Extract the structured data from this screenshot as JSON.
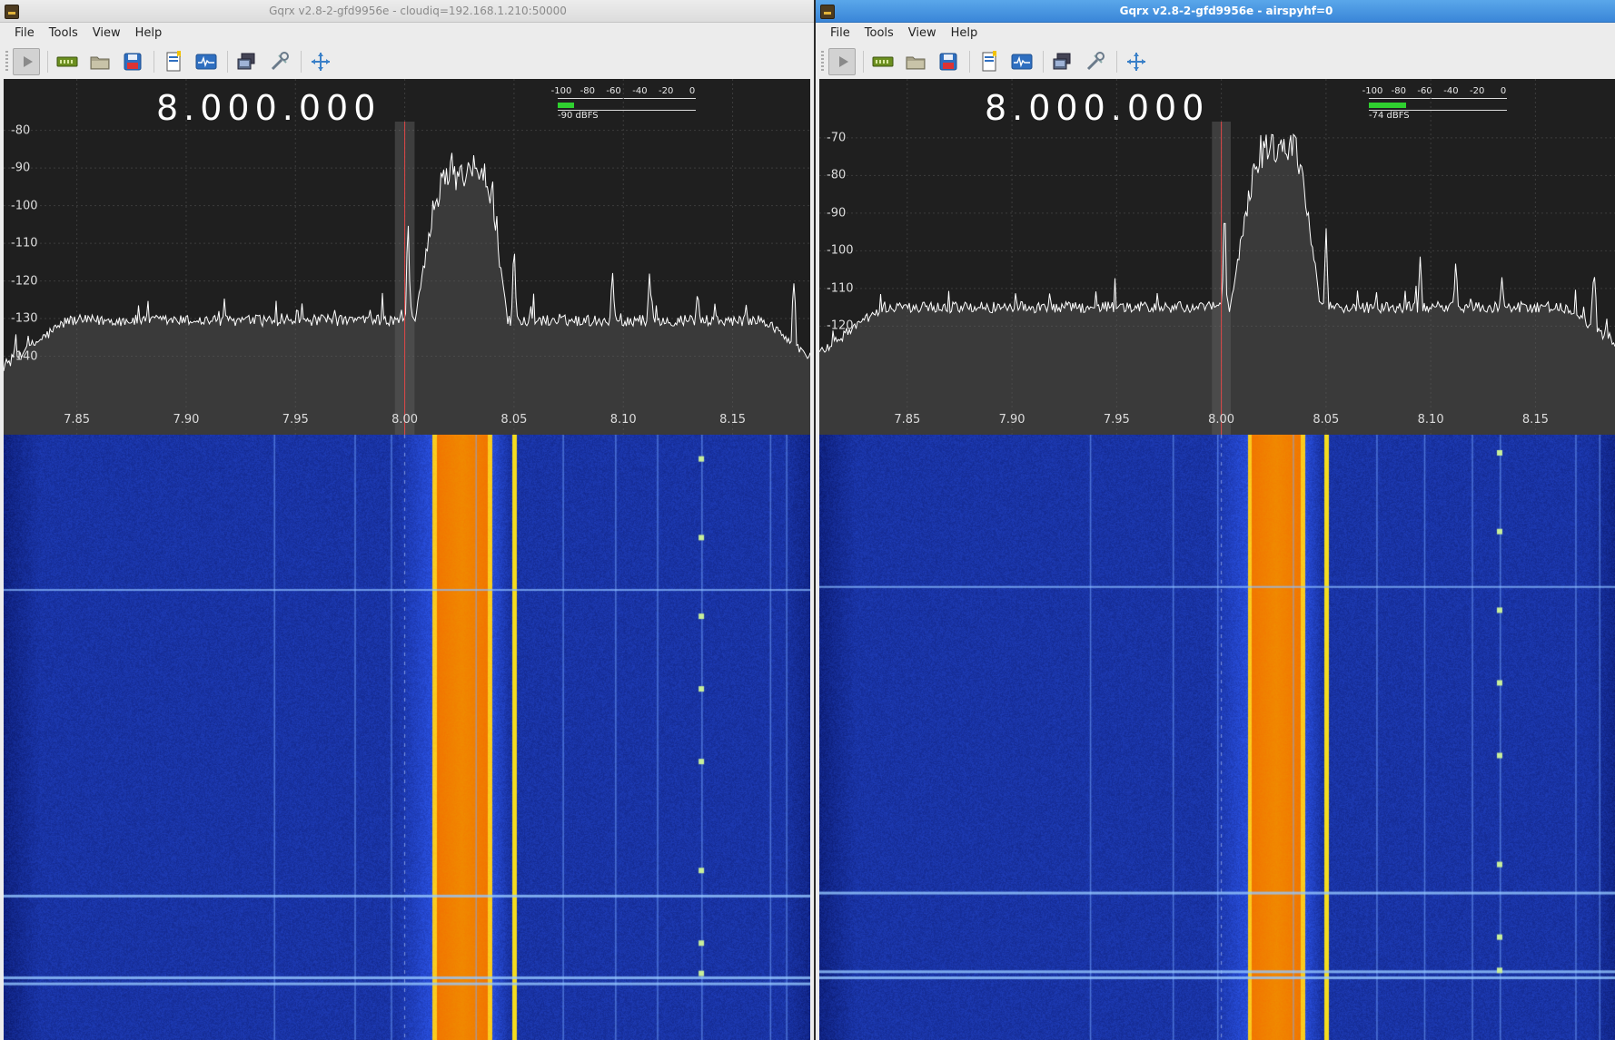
{
  "windows": [
    {
      "id": "left",
      "title": "Gqrx v2.8-2-gfd9956e - cloudiq=192.168.1.210:50000",
      "active": false,
      "menu": [
        "File",
        "Tools",
        "View",
        "Help"
      ],
      "toolbar": [
        {
          "name": "start-dsp-icon",
          "pressed": true
        },
        {
          "name": "io-devices-icon"
        },
        {
          "name": "open-settings-icon"
        },
        {
          "name": "save-settings-icon"
        },
        {
          "name": "bookmark-icon"
        },
        {
          "name": "fft-settings-icon"
        },
        {
          "name": "remote-control-icon"
        },
        {
          "name": "tools-icon"
        },
        {
          "name": "fullscreen-icon"
        }
      ],
      "frequency": "8.000.000",
      "smeter": {
        "scale": [
          "-100",
          "-80",
          "-60",
          "-40",
          "-20",
          "0"
        ],
        "readout": "-90 dBFS",
        "level_dbfs": -90
      },
      "spectrum": {
        "db_ticks": [
          "-80",
          "-90",
          "-100",
          "-110",
          "-120",
          "-130",
          "-140"
        ],
        "db_max": -76,
        "db_min": -143,
        "floor_db": -130.5,
        "peak_db": -93,
        "freq_ticks": [
          "7.85",
          "7.90",
          "7.95",
          "8.00",
          "8.05",
          "8.10",
          "8.15"
        ],
        "freq_min_mhz": 7.8165,
        "freq_max_mhz": 8.1855
      },
      "waterfall": {
        "hlines": [
          0.255,
          0.76,
          0.895,
          0.905
        ],
        "vlines": [
          0.335,
          0.435,
          0.48,
          0.585,
          0.693,
          0.758,
          0.81,
          0.865,
          0.95,
          0.97
        ],
        "dots_x": 0.865,
        "dots_y": [
          0.04,
          0.17,
          0.3,
          0.42,
          0.54,
          0.72,
          0.84,
          0.89
        ]
      }
    },
    {
      "id": "right",
      "title": "Gqrx v2.8-2-gfd9956e - airspyhf=0",
      "active": true,
      "menu": [
        "File",
        "Tools",
        "View",
        "Help"
      ],
      "toolbar": [
        {
          "name": "start-dsp-icon",
          "pressed": true
        },
        {
          "name": "io-devices-icon"
        },
        {
          "name": "open-settings-icon"
        },
        {
          "name": "save-settings-icon"
        },
        {
          "name": "bookmark-icon"
        },
        {
          "name": "fft-settings-icon"
        },
        {
          "name": "remote-control-icon"
        },
        {
          "name": "tools-icon"
        },
        {
          "name": "fullscreen-icon"
        }
      ],
      "frequency": "8.000.000",
      "smeter": {
        "scale": [
          "-100",
          "-80",
          "-60",
          "-40",
          "-20",
          "0"
        ],
        "readout": "-74 dBFS",
        "level_dbfs": -74
      },
      "spectrum": {
        "db_ticks": [
          "-70",
          "-80",
          "-90",
          "-100",
          "-110",
          "-120"
        ],
        "db_max": -64,
        "db_min": -131,
        "floor_db": -115,
        "peak_db": -76,
        "freq_ticks": [
          "7.85",
          "7.90",
          "7.95",
          "8.00",
          "8.05",
          "8.10",
          "8.15"
        ],
        "freq_min_mhz": 7.808,
        "freq_max_mhz": 8.188
      },
      "waterfall": {
        "hlines": [
          0.25,
          0.755,
          0.885,
          0.895
        ],
        "vlines": [
          0.34,
          0.444,
          0.5,
          0.595,
          0.7,
          0.76,
          0.82,
          0.855,
          0.95,
          0.98
        ],
        "dots_x": 0.855,
        "dots_y": [
          0.03,
          0.16,
          0.29,
          0.41,
          0.53,
          0.71,
          0.83,
          0.885
        ]
      }
    }
  ],
  "colors": {
    "plot_bg": "#1f1f1f",
    "trace": "#ffffff",
    "filter_band": "rgba(120,120,120,0.35)",
    "tuning_line": "#e04848",
    "signal_core": "#ff7a00",
    "signal_edge": "#f2d21a",
    "waterfall_bg": "#0b2394"
  }
}
